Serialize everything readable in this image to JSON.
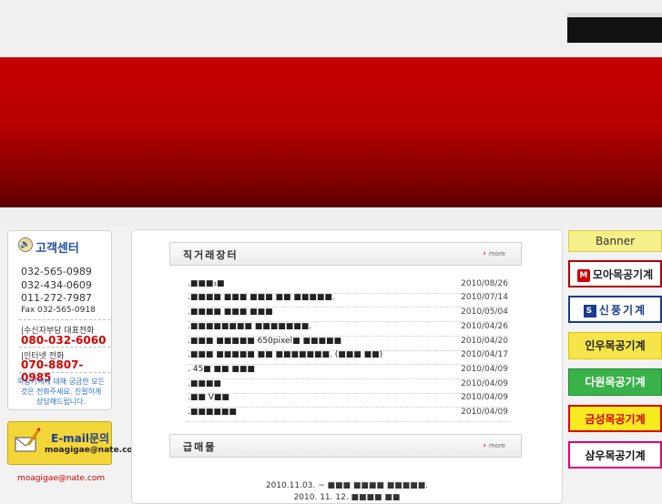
{
  "customer_center": {
    "title": "고객센터",
    "phones": [
      "032-565-0989",
      "032-434-0609",
      "011-272-7987"
    ],
    "fax": "Fax 032-565-0918",
    "rep_label": "|수신자부담 대표전화",
    "rep_phone": "080-032-6060",
    "inet_label": "|인터넷 전화",
    "inet_phone": "070-8807-0985",
    "note": "목공기계에 대해 궁금한 모든 것은 전화주세요. 친절하게 상담해드립니다."
  },
  "email_box": {
    "title": "E-mail문의",
    "address": "moagigae@nate.com",
    "link": "moagigae@nate.com"
  },
  "direct_market": {
    "title": "직거래장터",
    "more": "more",
    "posts": [
      {
        "text": ".■■■₃■",
        "date": "2010/08/26"
      },
      {
        "text": ".■■■■ ■■■ ■■■ ■■ ■■■■■.",
        "date": "2010/07/14"
      },
      {
        "text": ".■■■■ ■■■ ■■■",
        "date": "2010/05/04"
      },
      {
        "text": ".■■■■■■■■ ■■■■■■■.",
        "date": "2010/04/26"
      },
      {
        "text": ".■■■ ■■■■■ 650pixel■ ■■■■■",
        "date": "2010/04/20"
      },
      {
        "text": ".■■■ ■■■■■ ■■ ■■■■■■■. (■■■ ■■)",
        "date": "2010/04/17"
      },
      {
        "text": ". 45■ ■■ ■■■",
        "date": "2010/04/09"
      },
      {
        "text": ".■■■■",
        "date": "2010/04/09"
      },
      {
        "text": ".■■ V■■",
        "date": "2010/04/09"
      },
      {
        "text": ".■■■■■■",
        "date": "2010/04/09"
      }
    ]
  },
  "urgent_sale": {
    "title": "급매물",
    "more": "more",
    "items": [
      "2010.11.03. ~ ■■■ ■■■■ ■■■■■.",
      "2010. 11. 12. ■■■■ ■■"
    ]
  },
  "banners": {
    "header": "Banner",
    "items": [
      "모아목공기계",
      "신풍기계",
      "인우목공기계",
      "다원목공기계",
      "금성목공기계",
      "삼우목공기계"
    ]
  },
  "colors": {
    "hero_red": "#c40000",
    "accent_red": "#d40000",
    "brand_blue": "#1f4fa0"
  }
}
